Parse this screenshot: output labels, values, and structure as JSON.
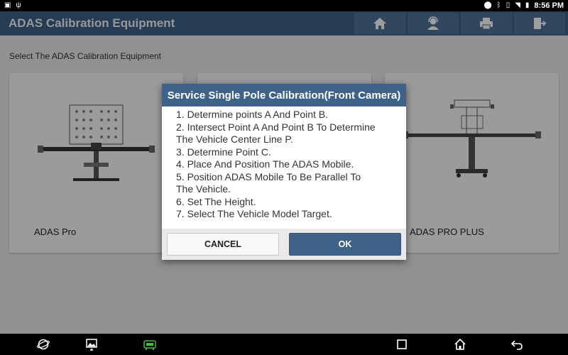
{
  "status_bar": {
    "time": "8:56 PM",
    "left_icons": [
      "image-icon",
      "usb-icon"
    ],
    "right_icons": [
      "location-icon",
      "bluetooth-icon",
      "vibrate-icon",
      "wifi-icon",
      "battery-icon"
    ]
  },
  "header": {
    "title": "ADAS Calibration Equipment",
    "buttons": [
      "home-icon",
      "support-icon",
      "print-icon",
      "exit-icon"
    ]
  },
  "main": {
    "subtitle": "Select The ADAS Calibration Equipment",
    "cards": [
      {
        "label": "ADAS Pro"
      },
      {
        "label": ""
      },
      {
        "label": "ADAS PRO PLUS"
      }
    ]
  },
  "dialog": {
    "title": "Service Single Pole Calibration(Front Camera)",
    "lines": [
      "1. Determine points A And Point B.",
      "2. Intersect Point A And Point B To Determine",
      "The Vehicle Center Line P.",
      "3. Determine Point C.",
      "4. Place And Position The ADAS Mobile.",
      "5. Position ADAS Mobile To Be Parallel To",
      "The Vehicle.",
      "6. Set The Height.",
      "7. Select The Vehicle Model Target."
    ],
    "cancel_label": "CANCEL",
    "ok_label": "OK"
  },
  "nav_bar": {
    "items": [
      "browser-icon",
      "gallery-icon",
      "vci-icon",
      "recents-icon",
      "home-icon",
      "back-icon"
    ],
    "vci_color": "#3fbf3f"
  }
}
